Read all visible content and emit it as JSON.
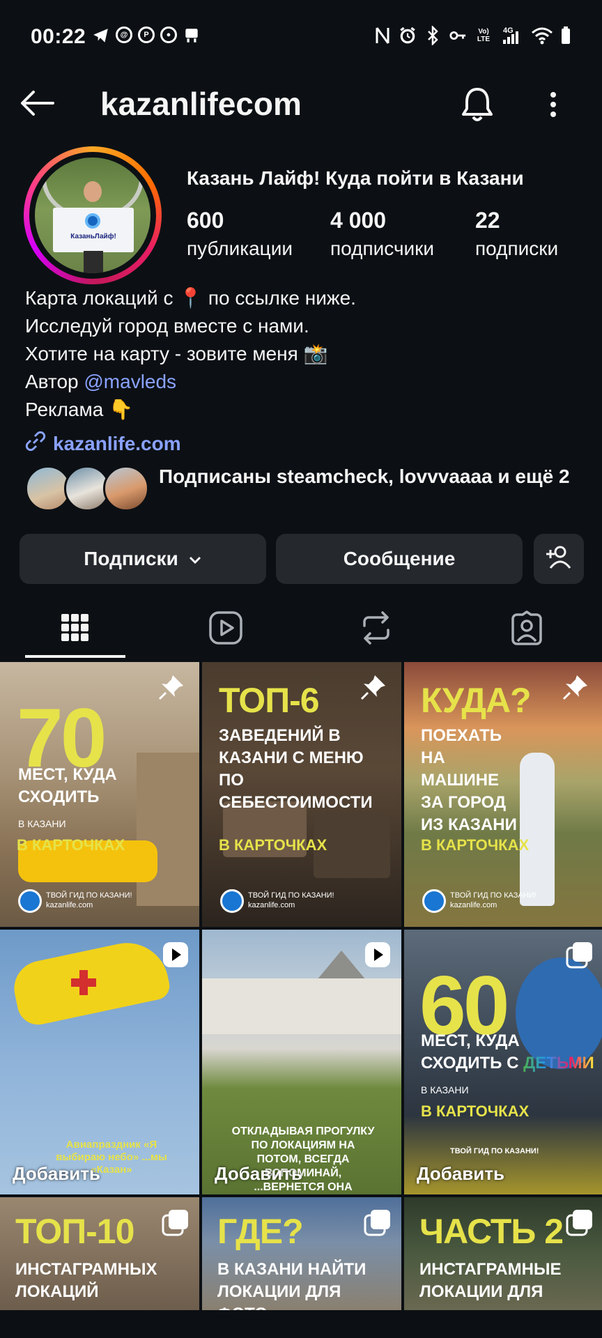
{
  "status_bar": {
    "time": "00:22",
    "left_icons": [
      "telegram-icon",
      "threads-icon",
      "pinterest-icon",
      "notification-icon",
      "app-icon"
    ],
    "right_icons": [
      "nfc-icon",
      "alarm-icon",
      "bluetooth-icon",
      "key-icon",
      "volte-icon",
      "signal-icon",
      "wifi-icon",
      "battery-icon"
    ],
    "network": "4G",
    "volte": "Vo) LTE"
  },
  "header": {
    "username": "kazanlifecom"
  },
  "profile": {
    "avatar_flag_text": "КазаньЛайф!",
    "full_name": "Казань Лайф! Куда пойти в Казани",
    "stats": [
      {
        "value": "600",
        "label": "публикации"
      },
      {
        "value": "4 000",
        "label": "подписчики"
      },
      {
        "value": "22",
        "label": "подписки"
      }
    ],
    "bio": {
      "line1": "Карта локаций с 📍 по ссылке ниже.",
      "line2": "Исследуй город вместе с нами.",
      "line3": "Хотите на карту - зовите меня 📸",
      "line4_prefix": "Автор ",
      "line4_handle": "@mavleds",
      "line5": "Реклама 👇"
    },
    "link": "kazanlife.com",
    "followed_by": "Подписаны steamcheck, lovvvaaaa и ещё 2"
  },
  "actions": {
    "following": "Подписки",
    "message": "Сообщение"
  },
  "tabs": [
    "grid-icon",
    "reels-icon",
    "reposts-icon",
    "tagged-icon"
  ],
  "posts": [
    {
      "big": "70",
      "title": "МЕСТ, КУДА СХОДИТЬ",
      "sub": "В КАЗАНИ",
      "cta": "В КАРТОЧКАХ",
      "foot1": "ТВОЙ ГИД ПО КАЗАНИ!",
      "foot2": "kazanlife.com"
    },
    {
      "big": "ТОП-6",
      "title": "ЗАВЕДЕНИЙ В КАЗАНИ С МЕНЮ ПО СЕБЕСТОИМОСТИ",
      "cta": "В КАРТОЧКАХ",
      "foot1": "ТВОЙ ГИД ПО КАЗАНИ!",
      "foot2": "kazanlife.com"
    },
    {
      "big": "КУДА?",
      "title": "ПОЕХАТЬ НА МАШИНЕ ЗА ГОРОД ИЗ КАЗАНИ",
      "cta": "В КАРТОЧКАХ",
      "foot1": "ТВОЙ ГИД ПО КАЗАНИ!",
      "foot2": "kazanlife.com"
    },
    {
      "caption": "Авиапраздник «Я выбираю небо» ...мы «Казан»",
      "add": "Добавить"
    },
    {
      "caption": "ОТКЛАДЫВАЯ ПРОГУЛКУ ПО ЛОКАЦИЯМ НА ПОТОМ, ВСЕГДА ВСПОМИНАЙ, ...ВЕРНЕТСЯ ОНА",
      "add": "Добавить"
    },
    {
      "big": "60",
      "title1": "МЕСТ, КУДА",
      "title2": "СХОДИТЬ С ",
      "title2b": "ДЕТЬМИ",
      "sub": "В КАЗАНИ",
      "cta": "В КАРТОЧКАХ",
      "foot1": "ТВОЙ ГИД ПО КАЗАНИ!",
      "add": "Добавить"
    },
    {
      "big": "ТОП-10",
      "title": "ИНСТАГРАМНЫХ ЛОКАЦИЙ"
    },
    {
      "big": "ГДЕ?",
      "title": "В КАЗАНИ НАЙТИ ЛОКАЦИИ ДЛЯ ФОТО"
    },
    {
      "big": "ЧАСТЬ 2",
      "title": "ИНСТАГРАМНЫЕ ЛОКАЦИИ ДЛЯ"
    }
  ]
}
